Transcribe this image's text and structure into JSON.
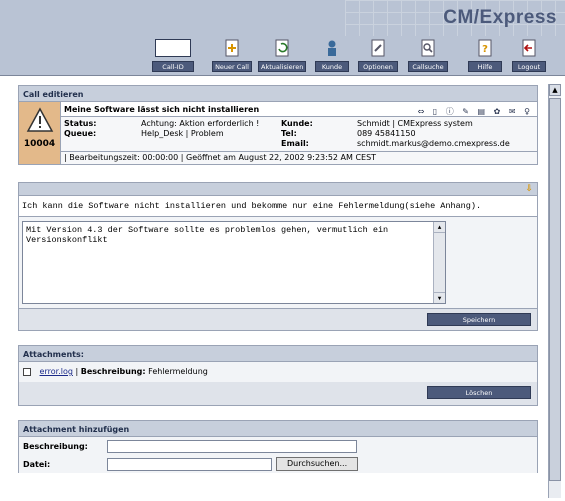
{
  "app": {
    "brand": "CM/Express"
  },
  "toolbar": {
    "callid_label": "Call-ID",
    "items": [
      {
        "label": "Neuer Call",
        "icon": "new-call-icon"
      },
      {
        "label": "Aktualisieren",
        "icon": "refresh-icon"
      },
      {
        "label": "Kunde",
        "icon": "customer-icon"
      },
      {
        "label": "Optionen",
        "icon": "options-icon"
      },
      {
        "label": "Callsuche",
        "icon": "call-search-icon"
      },
      {
        "label": "Hilfe",
        "icon": "help-icon"
      },
      {
        "label": "Logout",
        "icon": "logout-icon"
      }
    ]
  },
  "call_edit": {
    "section_title": "Call editieren",
    "call_number": "10004",
    "subject": "Meine Software lässt sich nicht installieren",
    "status_label": "Status:",
    "status_value": "Achtung: Aktion erforderlich !",
    "queue_label": "Queue:",
    "queue_value": "Help_Desk | Problem",
    "customer_label": "Kunde:",
    "customer_value": "Schmidt | CMExpress system",
    "tel_label": "Tel:",
    "tel_value": "089 45841150",
    "email_label": "Email:",
    "email_value": "schmidt.markus@demo.cmexpress.de",
    "time_line": "| Bearbeitungszeit: 00:00:00 | Geöffnet am August 22, 2002 9:23:52 AM CEST",
    "action_icons": "⇔ ▯ ⓘ ✎ ▤ ✿ ✉ ♀"
  },
  "description": {
    "text": "Ich kann die Software nicht installieren und bekomme nur eine Fehlermeldung(siehe Anhang).",
    "reply_text": "Mit Version 4.3 der Software sollte es problemlos gehen, vermutlich ein Versionskonflikt",
    "save_button": "Speichern"
  },
  "attachments": {
    "section_title": "Attachments:",
    "file_name": "error.log",
    "separator": "|",
    "description_label": "Beschreibung:",
    "description_value": "Fehlermeldung",
    "delete_button": "Löschen"
  },
  "add_attachment": {
    "section_title": "Attachment hinzufügen",
    "description_label": "Beschreibung:",
    "file_label": "Datei:",
    "browse_button": "Durchsuchen..."
  },
  "colors": {
    "header_bg": "#b9c3d4",
    "button_dark": "#4c5a7b",
    "call_badge": "#e3b98a"
  }
}
